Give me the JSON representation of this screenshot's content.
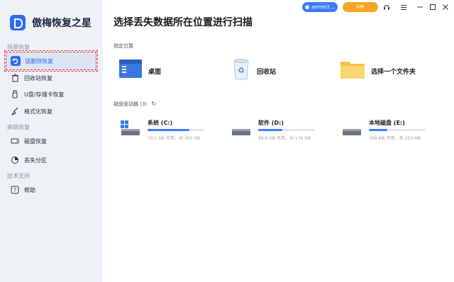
{
  "app": {
    "title": "傲梅恢复之星"
  },
  "topbar": {
    "user": "aomei2...",
    "vip": "VIP"
  },
  "sidebar": {
    "sections": [
      {
        "title": "场景恢复",
        "items": [
          {
            "label": "误删除恢复",
            "icon": "undo-icon",
            "active": true
          },
          {
            "label": "回收站恢复",
            "icon": "trash-icon"
          },
          {
            "label": "U盘/存储卡恢复",
            "icon": "usb-icon"
          },
          {
            "label": "格式化恢复",
            "icon": "broom-icon"
          }
        ]
      },
      {
        "title": "高级恢复",
        "items": [
          {
            "label": "磁盘恢复",
            "icon": "disk-icon"
          },
          {
            "label": "丢失分区",
            "icon": "partition-icon"
          }
        ]
      },
      {
        "title": "技术支持",
        "items": [
          {
            "label": "帮助",
            "icon": "help-icon"
          }
        ]
      }
    ]
  },
  "main": {
    "title": "选择丢失数据所在位置进行扫描",
    "locations_label": "指定位置",
    "locations": [
      {
        "name": "桌面",
        "icon": "desktop-icon"
      },
      {
        "name": "回收站",
        "icon": "recycle-bin-icon"
      },
      {
        "name": "选择一个文件夹",
        "icon": "folder-icon"
      }
    ],
    "drives_label": "磁盘驱动器 (3)",
    "drives": [
      {
        "name": "系统 (C:)",
        "capacity": "79.1 GB 可用，共 300 GB",
        "used_fraction": 0.74,
        "system": true
      },
      {
        "name": "软件 (D:)",
        "capacity": "99.6 GB 可用，共 176 GB",
        "used_fraction": 0.43
      },
      {
        "name": "本地磁盘 (E:)",
        "capacity": "169 MB 可用，共 253 MB",
        "used_fraction": 0.33
      }
    ]
  },
  "colors": {
    "accent": "#2f6cf6",
    "vip": "#f6a623",
    "sidebar_bg": "#eef1f6",
    "highlight": "#e0344a"
  }
}
